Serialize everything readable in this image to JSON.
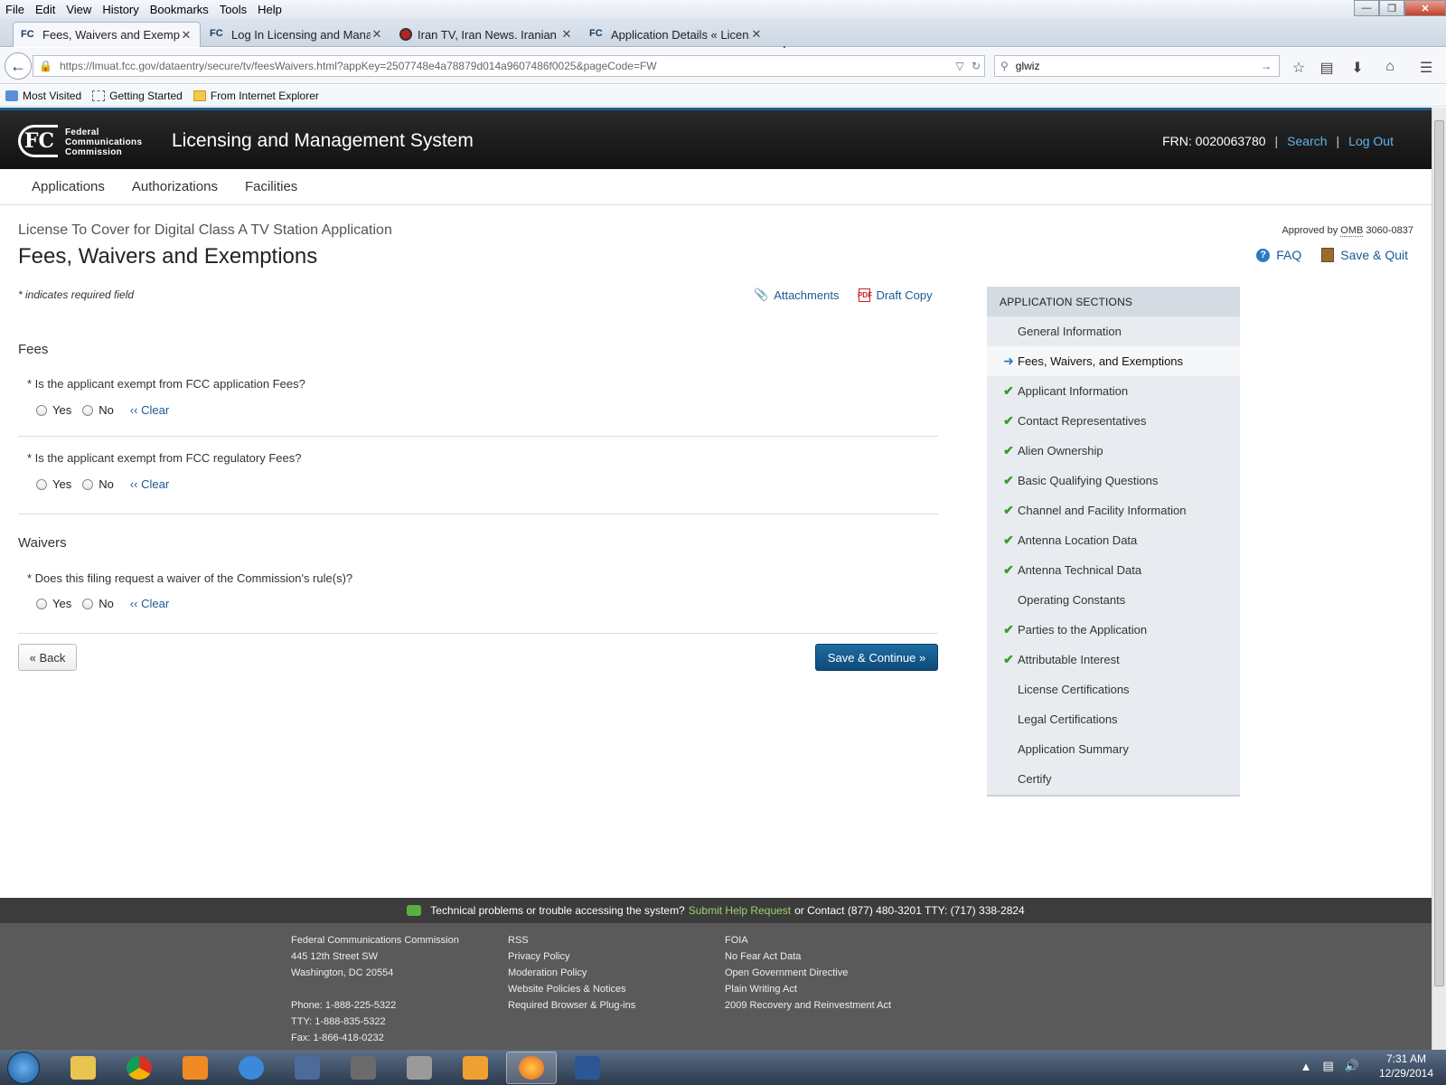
{
  "browser": {
    "menu": [
      "File",
      "Edit",
      "View",
      "History",
      "Bookmarks",
      "Tools",
      "Help"
    ],
    "tabs": [
      {
        "title": "Fees, Waivers and Exempti...",
        "favicon": "FC"
      },
      {
        "title": "Log In Licensing and Mana...",
        "favicon": "FC"
      },
      {
        "title": "Iran TV, Iran News. Iranian ...",
        "favicon": "globe"
      },
      {
        "title": "Application Details « Licen...",
        "favicon": "FC"
      }
    ],
    "url": "https://lmuat.fcc.gov/dataentry/secure/tv/feesWaivers.html?appKey=2507748e4a78879d014a9607486f0025&pageCode=FW",
    "search_value": "glwiz",
    "bookmarks": [
      "Most Visited",
      "Getting Started",
      "From Internet Explorer"
    ]
  },
  "site": {
    "agency_line1": "Federal",
    "agency_line2": "Communications",
    "agency_line3": "Commission",
    "logo_text": "FC",
    "system_title": "Licensing and Management System",
    "frn": "FRN: 0020063780",
    "search_link": "Search",
    "logout_link": "Log Out",
    "nav": [
      "Applications",
      "Authorizations",
      "Facilities"
    ]
  },
  "page": {
    "subtitle": "License To Cover for Digital Class A TV Station Application",
    "title": "Fees, Waivers and Exemptions",
    "omb_prefix": "Approved by",
    "omb_abbr": "OMB",
    "omb_number": "3060-0837",
    "faq": "FAQ",
    "save_quit": "Save & Quit",
    "required_note": "* indicates required field",
    "attachments": "Attachments",
    "draft_copy": "Draft Copy",
    "pdf_label": "PDF",
    "sections": {
      "fees": "Fees",
      "waivers": "Waivers"
    },
    "questions": [
      "* Is the applicant exempt from FCC application Fees?",
      "* Is the applicant exempt from FCC regulatory Fees?",
      "* Does this filing request a waiver of the Commission's rule(s)?"
    ],
    "yes": "Yes",
    "no": "No",
    "clear": "‹‹ Clear",
    "back_button": "« Back",
    "save_continue": "Save & Continue »"
  },
  "sidebar": {
    "header": "APPLICATION SECTIONS",
    "items": [
      {
        "label": "General Information",
        "status": "none"
      },
      {
        "label": "Fees, Waivers, and Exemptions",
        "status": "current"
      },
      {
        "label": "Applicant Information",
        "status": "complete"
      },
      {
        "label": "Contact Representatives",
        "status": "complete"
      },
      {
        "label": "Alien Ownership",
        "status": "complete"
      },
      {
        "label": "Basic Qualifying Questions",
        "status": "complete"
      },
      {
        "label": "Channel and Facility Information",
        "status": "complete"
      },
      {
        "label": "Antenna Location Data",
        "status": "complete"
      },
      {
        "label": "Antenna Technical Data",
        "status": "complete"
      },
      {
        "label": "Operating Constants",
        "status": "none"
      },
      {
        "label": "Parties to the Application",
        "status": "complete"
      },
      {
        "label": "Attributable Interest",
        "status": "complete"
      },
      {
        "label": "License Certifications",
        "status": "none"
      },
      {
        "label": "Legal Certifications",
        "status": "none"
      },
      {
        "label": "Application Summary",
        "status": "none"
      },
      {
        "label": "Certify",
        "status": "none"
      }
    ]
  },
  "footer": {
    "help_pre": "Technical problems or trouble accessing the system?",
    "help_link": "Submit Help Request",
    "help_post": "or Contact (877) 480-3201 TTY: (717) 338-2824",
    "col1": [
      "Federal Communications Commission",
      "445 12th Street SW",
      "Washington, DC 20554",
      "",
      "Phone: 1-888-225-5322",
      "TTY: 1-888-835-5322",
      "Fax: 1-866-418-0232"
    ],
    "col2": [
      "RSS",
      "Privacy Policy",
      "Moderation Policy",
      "Website Policies & Notices",
      "Required Browser & Plug-ins"
    ],
    "col3": [
      "FOIA",
      "No Fear Act Data",
      "Open Government Directive",
      "Plain Writing Act",
      "2009 Recovery and Reinvestment Act"
    ]
  },
  "taskbar": {
    "time": "7:31 AM",
    "date": "12/29/2014"
  },
  "colors": {
    "accent_link": "#1a5a96",
    "header_bg": "#111111",
    "primary_button": "#0d4a78",
    "check_green": "#3a9a2a"
  }
}
